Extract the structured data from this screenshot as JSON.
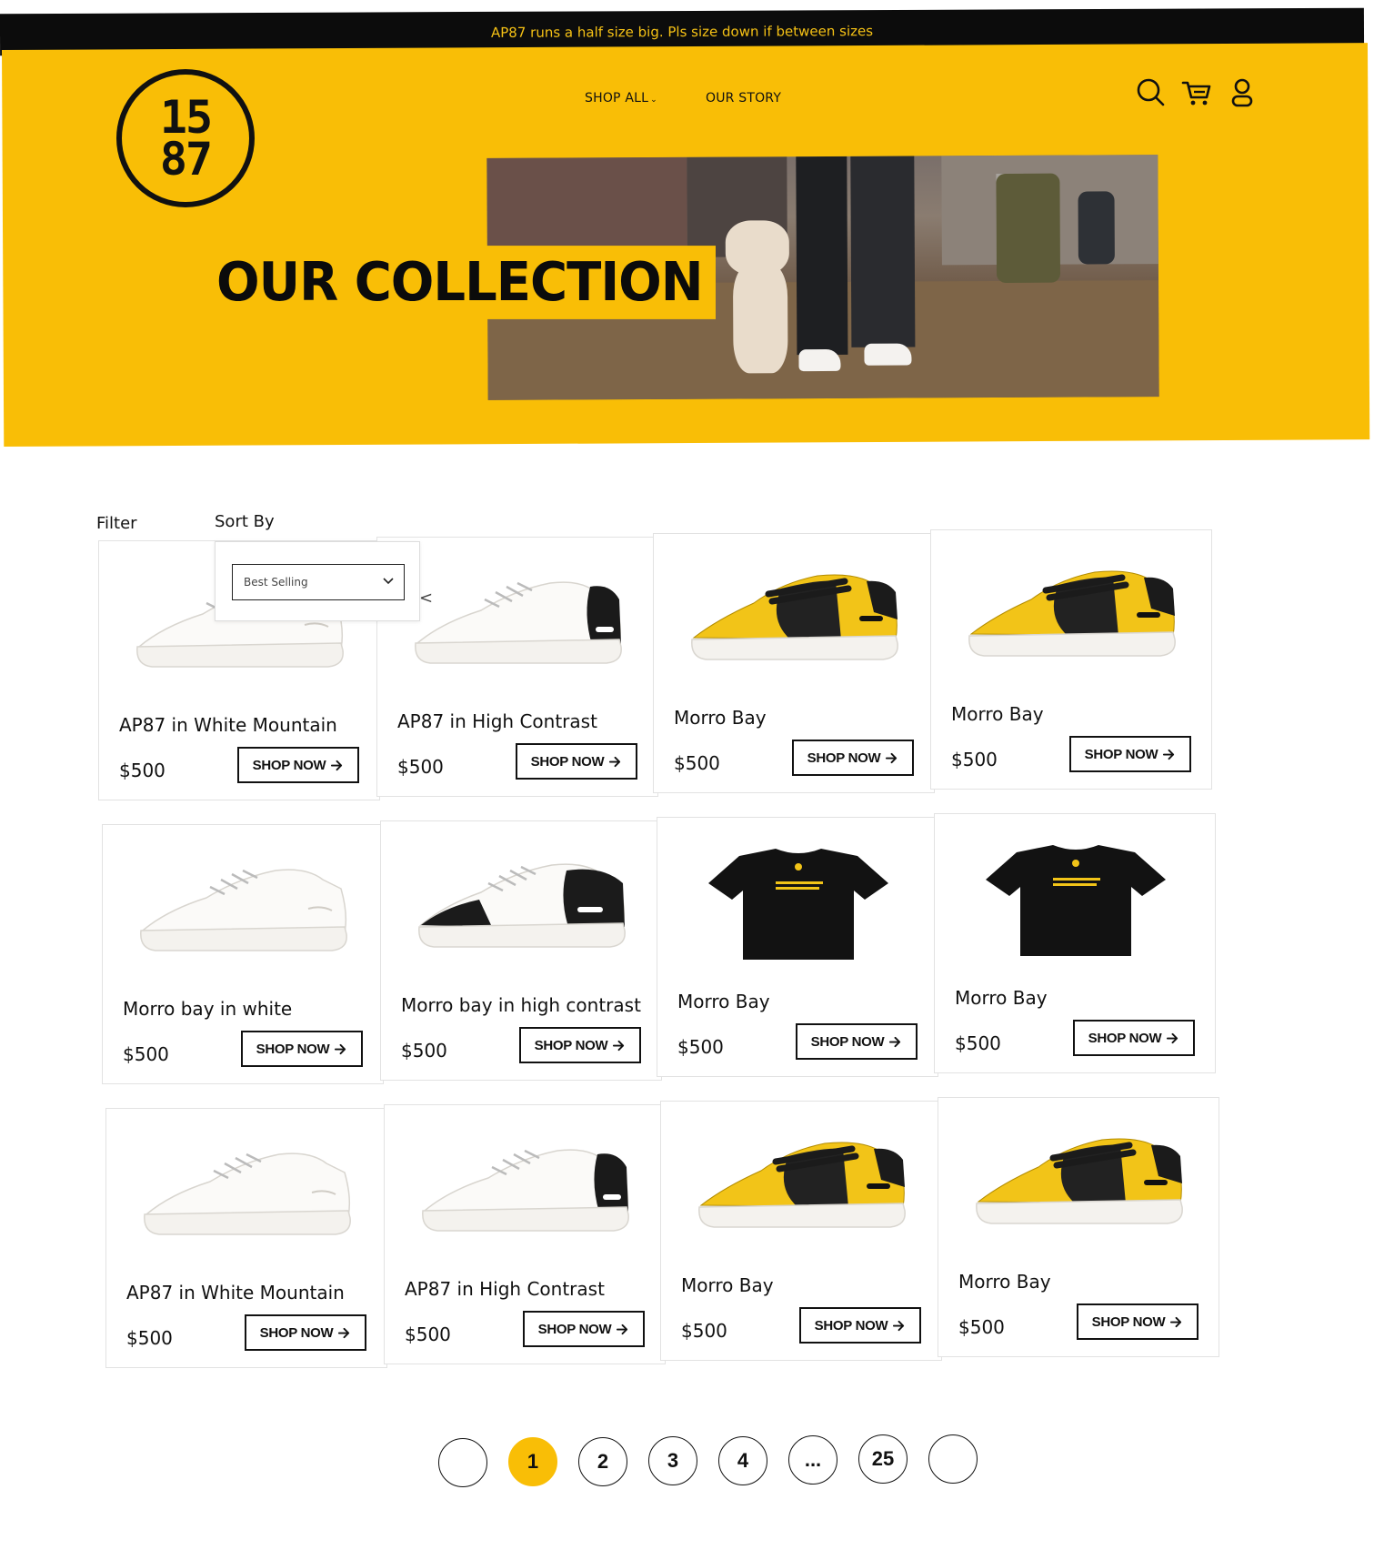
{
  "announcement": "AP87 runs a half size big. Pls size down if between sizes",
  "brand": {
    "logo_top": "15",
    "logo_bottom": "87"
  },
  "nav": {
    "shop_all": "SHOP ALL",
    "our_story": "OUR STORY",
    "icons": [
      "search-icon",
      "cart-icon",
      "account-icon"
    ]
  },
  "hero": {
    "title": "OUR COLLECTION"
  },
  "controls": {
    "filter_label": "Filter",
    "sort_label": "Sort By",
    "sort_value": "Best Selling",
    "carousel_prev": "<"
  },
  "products": [
    {
      "name": "AP87 in White Mountain",
      "price": "$500",
      "cta": "SHOP NOW",
      "image": "white-sneaker"
    },
    {
      "name": "AP87 in High Contrast",
      "price": "$500",
      "cta": "SHOP NOW",
      "image": "white-black-heel-sneaker"
    },
    {
      "name": "Morro Bay",
      "price": "$500",
      "cta": "SHOP NOW",
      "image": "yellow-black-sneaker"
    },
    {
      "name": "Morro Bay",
      "price": "$500",
      "cta": "SHOP NOW",
      "image": "yellow-black-sneaker"
    },
    {
      "name": "Morro bay in white",
      "price": "$500",
      "cta": "SHOP NOW",
      "image": "white-court-sneaker"
    },
    {
      "name": "Morro bay in high contrast",
      "price": "$500",
      "cta": "SHOP NOW",
      "image": "black-white-court-sneaker"
    },
    {
      "name": "Morro Bay",
      "price": "$500",
      "cta": "SHOP NOW",
      "image": "black-tshirt"
    },
    {
      "name": "Morro Bay",
      "price": "$500",
      "cta": "SHOP NOW",
      "image": "black-tshirt"
    },
    {
      "name": "AP87 in White Mountain",
      "price": "$500",
      "cta": "SHOP NOW",
      "image": "white-sneaker"
    },
    {
      "name": "AP87 in High Contrast",
      "price": "$500",
      "cta": "SHOP NOW",
      "image": "white-black-heel-sneaker"
    },
    {
      "name": "Morro Bay",
      "price": "$500",
      "cta": "SHOP NOW",
      "image": "yellow-black-sneaker"
    },
    {
      "name": "Morro Bay",
      "price": "$500",
      "cta": "SHOP NOW",
      "image": "yellow-black-sneaker"
    }
  ],
  "pagination": {
    "pages": [
      "",
      "1",
      "2",
      "3",
      "4",
      "...",
      "25",
      ""
    ],
    "active": "1"
  },
  "colors": {
    "accent": "#f9be06",
    "dark": "#0c0c0c",
    "white": "#ffffff"
  }
}
